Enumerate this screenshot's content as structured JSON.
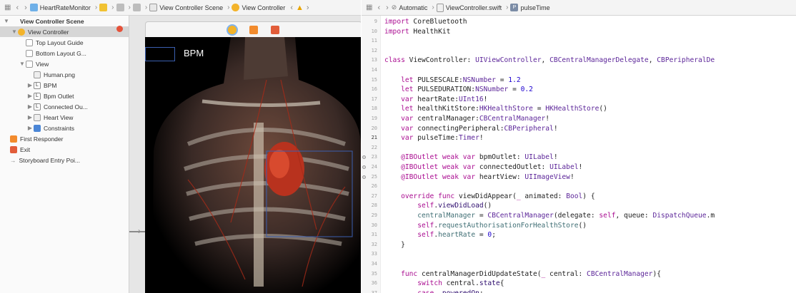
{
  "left_jumpbar": {
    "items": [
      "HeartRateMonitor",
      "View Controller Scene",
      "View Controller"
    ]
  },
  "right_jumpbar": {
    "items": [
      "Automatic",
      "ViewController.swift",
      "pulseTime"
    ]
  },
  "outline": {
    "rows": [
      {
        "label": "View Controller Scene",
        "indent": 0,
        "tri": "▼",
        "icon": "scene"
      },
      {
        "label": "View Controller",
        "indent": 1,
        "tri": "▼",
        "icon": "vc",
        "selected": true
      },
      {
        "label": "Top Layout Guide",
        "indent": 2,
        "tri": "",
        "icon": "box"
      },
      {
        "label": "Bottom Layout G...",
        "indent": 2,
        "tri": "",
        "icon": "box"
      },
      {
        "label": "View",
        "indent": 2,
        "tri": "▼",
        "icon": "box"
      },
      {
        "label": "Human.png",
        "indent": 3,
        "tri": "",
        "icon": "img"
      },
      {
        "label": "BPM",
        "indent": 3,
        "tri": "▶",
        "icon": "label"
      },
      {
        "label": "Bpm Outlet",
        "indent": 3,
        "tri": "▶",
        "icon": "label"
      },
      {
        "label": "Connected Ou...",
        "indent": 3,
        "tri": "▶",
        "icon": "label"
      },
      {
        "label": "Heart View",
        "indent": 3,
        "tri": "▶",
        "icon": "img"
      },
      {
        "label": "Constraints",
        "indent": 3,
        "tri": "▶",
        "icon": "cons"
      },
      {
        "label": "First Responder",
        "indent": 0,
        "tri": "",
        "icon": "resp"
      },
      {
        "label": "Exit",
        "indent": 0,
        "tri": "",
        "icon": "exit"
      },
      {
        "label": "Storyboard Entry Poi...",
        "indent": 0,
        "tri": "",
        "icon": "arrow"
      }
    ]
  },
  "canvas": {
    "bpm_label": "BPM"
  },
  "code_lines": [
    {
      "n": "9",
      "html": "<span class=\"kw\">import</span> CoreBluetooth"
    },
    {
      "n": "10",
      "html": "<span class=\"kw\">import</span> HealthKit"
    },
    {
      "n": "11",
      "html": ""
    },
    {
      "n": "12",
      "html": ""
    },
    {
      "n": "13",
      "html": "<span class=\"kw\">class</span> ViewController: <span class=\"tp\">UIViewController</span>, <span class=\"tp\">CBCentralManagerDelegate</span>, <span class=\"tp\">CBPeripheralDe</span>"
    },
    {
      "n": "14",
      "html": ""
    },
    {
      "n": "15",
      "html": "    <span class=\"kw\">let</span> PULSESCALE:<span class=\"tp\">NSNumber</span> = <span class=\"nu\">1.2</span>"
    },
    {
      "n": "16",
      "html": "    <span class=\"kw\">let</span> PULSEDURATION:<span class=\"tp\">NSNumber</span> = <span class=\"nu\">0.2</span>"
    },
    {
      "n": "17",
      "html": "    <span class=\"kw\">var</span> heartRate:<span class=\"tp\">UInt16</span>!"
    },
    {
      "n": "18",
      "html": "    <span class=\"kw\">let</span> healthKitStore:<span class=\"tp\">HKHealthStore</span> = <span class=\"tp\">HKHealthStore</span>()"
    },
    {
      "n": "19",
      "html": "    <span class=\"kw\">var</span> centralManager:<span class=\"tp\">CBCentralManager</span>!"
    },
    {
      "n": "20",
      "html": "    <span class=\"kw\">var</span> connectingPeripheral:<span class=\"tp\">CBPeripheral</span>!"
    },
    {
      "n": "21",
      "html": "    <span class=\"kw\">var</span> pulseTime:<span class=\"tp\">Timer</span>!",
      "cur": true
    },
    {
      "n": "22",
      "html": ""
    },
    {
      "n": "23",
      "html": "    <span class=\"kw\">@IBOutlet</span> <span class=\"kw\">weak</span> <span class=\"kw\">var</span> bpmOutlet: <span class=\"tp\">UILabel</span>!",
      "dot": true
    },
    {
      "n": "24",
      "html": "    <span class=\"kw\">@IBOutlet</span> <span class=\"kw\">weak</span> <span class=\"kw\">var</span> connectedOutlet: <span class=\"tp\">UILabel</span>!",
      "dot": true
    },
    {
      "n": "25",
      "html": "    <span class=\"kw\">@IBOutlet</span> <span class=\"kw\">weak</span> <span class=\"kw\">var</span> heartView: <span class=\"tp\">UIImageView</span>!",
      "dot": true
    },
    {
      "n": "26",
      "html": ""
    },
    {
      "n": "27",
      "html": "    <span class=\"kw\">override</span> <span class=\"kw\">func</span> viewDidAppear(<span class=\"kw\">_</span> animated: <span class=\"tp\">Bool</span>) {"
    },
    {
      "n": "28",
      "html": "        <span class=\"kw\">self</span>.<span class=\"pn\">viewDidLoad</span>()"
    },
    {
      "n": "29",
      "html": "        <span class=\"ty\">centralManager</span> = <span class=\"tp\">CBCentralManager</span>(delegate: <span class=\"kw\">self</span>, queue: <span class=\"tp\">DispatchQueue</span>.m"
    },
    {
      "n": "30",
      "html": "        <span class=\"kw\">self</span>.<span class=\"ty\">requestAuthorisationForHealthStore</span>()"
    },
    {
      "n": "31",
      "html": "        <span class=\"kw\">self</span>.<span class=\"ty\">heartRate</span> = <span class=\"nu\">0</span>;"
    },
    {
      "n": "32",
      "html": "    }"
    },
    {
      "n": "33",
      "html": ""
    },
    {
      "n": "34",
      "html": ""
    },
    {
      "n": "35",
      "html": "    <span class=\"kw\">func</span> centralManagerDidUpdateState(<span class=\"kw\">_</span> central: <span class=\"tp\">CBCentralManager</span>){"
    },
    {
      "n": "36",
      "html": "        <span class=\"kw\">switch</span> central.<span class=\"pn\">state</span>{"
    },
    {
      "n": "37",
      "html": "        <span class=\"kw\">case</span> .<span class=\"pn\">poweredOn</span>:"
    }
  ]
}
